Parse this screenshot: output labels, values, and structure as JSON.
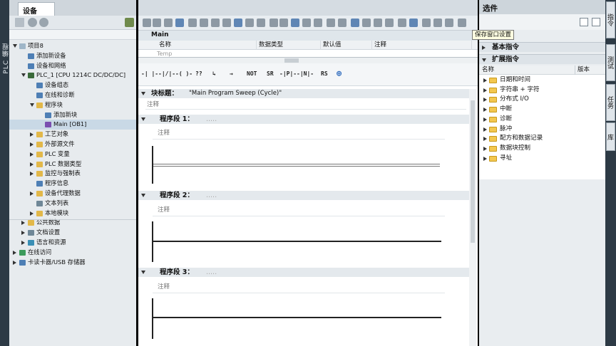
{
  "left_strip": {
    "label": "PLC 编程"
  },
  "project_tree": {
    "tab": "设备",
    "items": [
      {
        "label": "项目8",
        "indent": 0,
        "expanded": true,
        "icon": "project-icon"
      },
      {
        "label": "添加新设备",
        "indent": 1,
        "icon": "add-device-icon"
      },
      {
        "label": "设备和网络",
        "indent": 1,
        "icon": "network-icon"
      },
      {
        "label": "PLC_1 [CPU 1214C DC/DC/DC]",
        "indent": 1,
        "expanded": true,
        "icon": "plc-icon"
      },
      {
        "label": "设备组态",
        "indent": 2,
        "icon": "config-icon"
      },
      {
        "label": "在线和诊断",
        "indent": 2,
        "icon": "diagnostics-icon"
      },
      {
        "label": "程序块",
        "indent": 2,
        "expanded": true,
        "icon": "folder-icon"
      },
      {
        "label": "添加新块",
        "indent": 3,
        "icon": "add-block-icon"
      },
      {
        "label": "Main [OB1]",
        "indent": 3,
        "icon": "ob-icon",
        "selected": true
      },
      {
        "label": "工艺对象",
        "indent": 2,
        "collapsed": true,
        "icon": "folder-icon"
      },
      {
        "label": "外部源文件",
        "indent": 2,
        "collapsed": true,
        "icon": "folder-icon"
      },
      {
        "label": "PLC 变量",
        "indent": 2,
        "collapsed": true,
        "icon": "folder-icon"
      },
      {
        "label": "PLC 数据类型",
        "indent": 2,
        "collapsed": true,
        "icon": "folder-icon"
      },
      {
        "label": "监控与强制表",
        "indent": 2,
        "collapsed": true,
        "icon": "folder-icon"
      },
      {
        "label": "程序信息",
        "indent": 2,
        "icon": "info-icon"
      },
      {
        "label": "设备代理数据",
        "indent": 2,
        "collapsed": true,
        "icon": "folder-icon"
      },
      {
        "label": "文本列表",
        "indent": 2,
        "icon": "text-icon"
      },
      {
        "label": "本地模块",
        "indent": 2,
        "collapsed": true,
        "icon": "folder-icon"
      },
      {
        "label": "公共数据",
        "indent": 1,
        "collapsed": true,
        "icon": "folder-icon"
      },
      {
        "label": "文档设置",
        "indent": 1,
        "collapsed": true,
        "icon": "doc-icon"
      },
      {
        "label": "语言和资源",
        "indent": 1,
        "collapsed": true,
        "icon": "language-icon"
      },
      {
        "label": "在线访问",
        "indent": 0,
        "collapsed": true,
        "icon": "online-icon"
      },
      {
        "label": "卡读卡器/USB 存储器",
        "indent": 0,
        "collapsed": true,
        "icon": "card-reader-icon"
      }
    ]
  },
  "editor": {
    "block_title_bar": "Main",
    "interface_columns": [
      "名称",
      "数据类型",
      "默认值",
      "注释"
    ],
    "interface_row": "Temp",
    "ladder_symbols": [
      "-| |-",
      "-|/|-",
      "-( )-",
      "??",
      "↳",
      "→",
      "NOT",
      "SR",
      "-|P|-",
      "-|N|-",
      "RS",
      "⊕"
    ],
    "block_title_label": "块标题：",
    "block_title_value": "\"Main Program Sweep (Cycle)\"",
    "block_comment": "注释",
    "networks": [
      {
        "label": "程序段 1：",
        "comment": "注释",
        "dots": "....."
      },
      {
        "label": "程序段 2：",
        "comment": "注释",
        "dots": "....."
      },
      {
        "label": "程序段 3：",
        "comment": "注释",
        "dots": "....."
      }
    ]
  },
  "right_panel": {
    "title": "选件",
    "tooltip": "保存窗口设置",
    "sections": [
      {
        "label": "基本指令",
        "expanded": false
      },
      {
        "label": "扩展指令",
        "expanded": true
      }
    ],
    "ext_header": {
      "name": "名称",
      "version": "版本"
    },
    "ext_items": [
      "日期和时间",
      "字符串 + 字符",
      "分布式 I/O",
      "中断",
      "诊断",
      "脉冲",
      "配方和数据记录",
      "数据块控制",
      "寻址"
    ]
  },
  "right_strip": {
    "tabs": [
      "指令",
      "测试",
      "任务",
      "库"
    ]
  },
  "colors": {
    "selection": "#c9d9e6",
    "tooltip_bg": "#ffffe1",
    "dark_frame": "#2d3a45",
    "folder": "#f3c74f"
  }
}
